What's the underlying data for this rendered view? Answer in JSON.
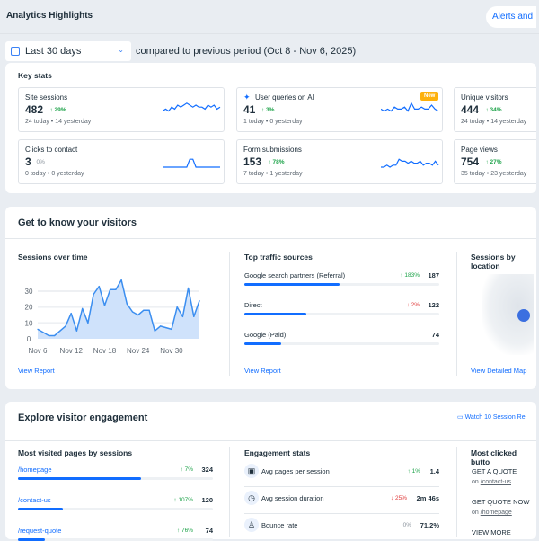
{
  "header": {
    "title": "Analytics Highlights",
    "alerts_label": "Alerts and"
  },
  "filter": {
    "range": "Last 30 days",
    "compare": "compared to previous period (Oct 8 - Nov 6, 2025)"
  },
  "key_stats": {
    "title": "Key stats",
    "cards": [
      {
        "label": "Site sessions",
        "value": "482",
        "change": "↑ 29%",
        "today": "24 today",
        "yesterday": "14 yesterday"
      },
      {
        "label": "User queries on AI",
        "value": "41",
        "change": "↑ 3%",
        "today": "1 today",
        "yesterday": "0 yesterday",
        "badge": "New"
      },
      {
        "label": "Unique visitors",
        "value": "444",
        "change": "↑ 34%",
        "today": "24 today",
        "yesterday": "14 yesterday"
      },
      {
        "label": "Clicks to contact",
        "value": "3",
        "change": "0%",
        "today": "0 today",
        "yesterday": "0 yesterday"
      },
      {
        "label": "Form submissions",
        "value": "153",
        "change": "↑ 78%",
        "today": "7 today",
        "yesterday": "1 yesterday"
      },
      {
        "label": "Page views",
        "value": "754",
        "change": "↑ 27%",
        "today": "35 today",
        "yesterday": "23 yesterday"
      }
    ]
  },
  "visitors": {
    "title": "Get to know your visitors",
    "sessions": {
      "title": "Sessions over time",
      "link": "View Report"
    },
    "traffic": {
      "title": "Top traffic sources",
      "link": "View Report",
      "items": [
        {
          "label": "Google search partners (Referral)",
          "change": "↑ 183%",
          "dir": "up",
          "value": "187",
          "fill": 0.49
        },
        {
          "label": "Direct",
          "change": "↓ 2%",
          "dir": "down",
          "value": "122",
          "fill": 0.32
        },
        {
          "label": "Google (Paid)",
          "change": "",
          "dir": "",
          "value": "74",
          "fill": 0.19
        }
      ]
    },
    "location": {
      "title": "Sessions by location",
      "link": "View Detailed Map"
    }
  },
  "engagement": {
    "title": "Explore visitor engagement",
    "watch": "Watch 10 Session Re",
    "pages": {
      "title": "Most visited pages by sessions",
      "items": [
        {
          "label": "/homepage",
          "change": "↑ 7%",
          "value": "324",
          "fill": 0.63
        },
        {
          "label": "/contact-us",
          "change": "↑ 107%",
          "value": "120",
          "fill": 0.23
        },
        {
          "label": "/request-quote",
          "change": "↑ 76%",
          "value": "74",
          "fill": 0.14
        }
      ]
    },
    "stats": {
      "title": "Engagement stats",
      "items": [
        {
          "label": "Avg pages per session",
          "change": "↑ 1%",
          "dir": "up",
          "value": "1.4"
        },
        {
          "label": "Avg session duration",
          "change": "↓ 25%",
          "dir": "down",
          "value": "2m 46s"
        },
        {
          "label": "Bounce rate",
          "change": "0%",
          "dir": "",
          "value": "71.2%"
        }
      ]
    },
    "buttons": {
      "title": "Most clicked butto",
      "items": [
        {
          "label": "GET A QUOTE",
          "on": "on",
          "page": "/contact-us"
        },
        {
          "label": "GET QUOTE NOW",
          "on": "on",
          "page": "/homepage"
        },
        {
          "label": "VIEW MORE"
        }
      ]
    }
  },
  "chart_data": {
    "type": "area",
    "title": "Sessions over time",
    "x_ticks": [
      "Nov 6",
      "Nov 12",
      "Nov 18",
      "Nov 24",
      "Nov 30"
    ],
    "y_ticks": [
      "0",
      "10",
      "20",
      "30"
    ],
    "ylim": [
      0,
      40
    ],
    "grid": true,
    "color": "#3b8ef0",
    "x": [
      "Nov 6",
      "Nov 7",
      "Nov 8",
      "Nov 9",
      "Nov 10",
      "Nov 11",
      "Nov 12",
      "Nov 13",
      "Nov 14",
      "Nov 15",
      "Nov 16",
      "Nov 17",
      "Nov 18",
      "Nov 19",
      "Nov 20",
      "Nov 21",
      "Nov 22",
      "Nov 23",
      "Nov 24",
      "Nov 25",
      "Nov 26",
      "Nov 27",
      "Nov 28",
      "Nov 29",
      "Nov 30",
      "Dec 1",
      "Dec 2",
      "Dec 3",
      "Dec 4",
      "Dec 5"
    ],
    "values": [
      6,
      4,
      2,
      2,
      5,
      8,
      16,
      5,
      19,
      10,
      28,
      33,
      21,
      31,
      31,
      37,
      22,
      17,
      15,
      18,
      18,
      5,
      8,
      7,
      6,
      20,
      14,
      32,
      14,
      24
    ]
  }
}
